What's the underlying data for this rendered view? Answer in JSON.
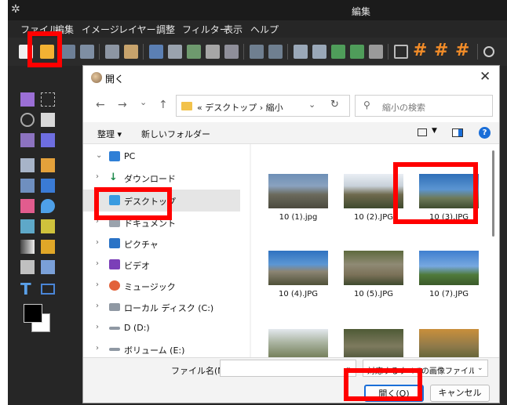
{
  "window": {
    "title": "編集"
  },
  "menu": [
    "ファイル",
    "編集",
    "イメージ",
    "レイヤー",
    "調整",
    "フィルター",
    "表示",
    "ヘルプ"
  ],
  "icons": {
    "app": "gear-icon",
    "open_folder": "folder-open-icon",
    "grid": "grid-icon",
    "hash": "hash-icon"
  },
  "colors": {
    "highlight": "#ff0000",
    "accent": "#1a6ed8",
    "toolbar_orange": "#f28c28"
  },
  "dialog": {
    "title": "開く",
    "close": "✕",
    "nav": {
      "back": "←",
      "forward": "→",
      "recent": "⌄",
      "up": "↑"
    },
    "address": {
      "prefix": "«",
      "parts": [
        "デスクトップ",
        "縮小"
      ],
      "separator": "›"
    },
    "search_placeholder": "縮小の検索",
    "commands": {
      "organize": "整理 ▾",
      "new_folder": "新しいフォルダー"
    },
    "tree": [
      {
        "label": "PC",
        "chevron": "⌄",
        "icon": "pc-icon"
      },
      {
        "label": "ダウンロード",
        "chevron": "›",
        "icon": "download-icon"
      },
      {
        "label": "デスクトップ",
        "chevron": "",
        "icon": "desktop-icon",
        "selected": true
      },
      {
        "label": "ドキュメント",
        "chevron": "›",
        "icon": "document-icon"
      },
      {
        "label": "ピクチャ",
        "chevron": "›",
        "icon": "pictures-icon"
      },
      {
        "label": "ビデオ",
        "chevron": "›",
        "icon": "video-icon"
      },
      {
        "label": "ミュージック",
        "chevron": "›",
        "icon": "music-icon"
      },
      {
        "label": "ローカル ディスク (C:)",
        "chevron": "›",
        "icon": "drive-icon"
      },
      {
        "label": "D (D:)",
        "chevron": "›",
        "icon": "drive-icon"
      },
      {
        "label": "ボリューム (E:)",
        "chevron": "›",
        "icon": "drive-icon"
      }
    ],
    "files": [
      {
        "name": "10 (1).jpg"
      },
      {
        "name": "10 (2).JPG"
      },
      {
        "name": "10 (3).JPG"
      },
      {
        "name": "10 (4).JPG"
      },
      {
        "name": "10 (5).JPG"
      },
      {
        "name": "10 (7).JPG"
      },
      {
        "name": ""
      },
      {
        "name": ""
      },
      {
        "name": ""
      }
    ],
    "filename_label": "ファイル名(N):",
    "filename_value": "",
    "filetype": "対応するすべての画像ファイル (*.pt",
    "open_button": "開く(O)",
    "cancel_button": "キャンセル"
  }
}
